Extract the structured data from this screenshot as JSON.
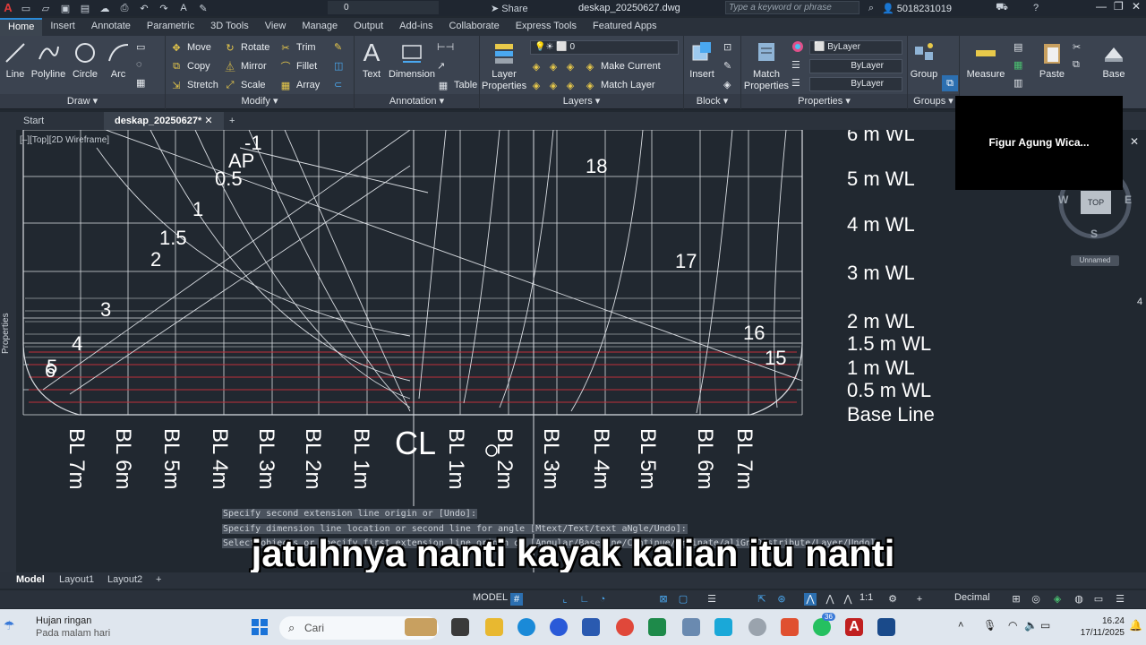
{
  "app": {
    "logo_letter": "A",
    "file_title": "deskap_20250627.dwg",
    "search_placeholder": "Type a keyword or phrase",
    "user_id": "5018231019",
    "share_label": "Share",
    "qat_layer_value": "0",
    "window_controls": [
      "—",
      "❐",
      "✕"
    ]
  },
  "ribbon_tabs": [
    "Home",
    "Insert",
    "Annotate",
    "Parametric",
    "3D Tools",
    "View",
    "Manage",
    "Output",
    "Add-ins",
    "Collaborate",
    "Express Tools",
    "Featured Apps"
  ],
  "ribbon": {
    "draw": {
      "title": "Draw",
      "line": "Line",
      "polyline": "Polyline",
      "circle": "Circle",
      "arc": "Arc"
    },
    "modify": {
      "title": "Modify",
      "move": "Move",
      "rotate": "Rotate",
      "trim": "Trim",
      "copy": "Copy",
      "mirror": "Mirror",
      "fillet": "Fillet",
      "stretch": "Stretch",
      "scale": "Scale",
      "array": "Array"
    },
    "annotation": {
      "title": "Annotation",
      "text": "Text",
      "dimension": "Dimension",
      "table": "Table"
    },
    "layers": {
      "title": "Layers",
      "layer_properties": "Layer Properties",
      "current_layer": "0",
      "make_current": "Make Current",
      "match_layer": "Match Layer"
    },
    "block": {
      "title": "Block",
      "insert": "Insert"
    },
    "properties": {
      "title": "Properties",
      "match_properties": "Match Properties",
      "color": "ByLayer",
      "linetype": "ByLayer",
      "lineweight": "ByLayer"
    },
    "groups": {
      "title": "Groups",
      "group": "Group"
    },
    "utilities": {
      "measure": "Measure"
    },
    "clipboard": {
      "paste": "Paste"
    },
    "view": {
      "base": "Base"
    }
  },
  "doc_tabs": {
    "start": "Start",
    "active": "deskap_20250627*",
    "close": "✕",
    "add": "+"
  },
  "viewport_label": "[–][Top][2D Wireframe]",
  "side_panel_label": "Properties",
  "viewcube": {
    "top": "TOP",
    "west": "W",
    "east": "E",
    "south": "S",
    "ucs": "Unnamed"
  },
  "overlay_name": "Figur Agung Wica...",
  "drawing": {
    "station_labels": [
      "-1",
      "AP",
      "0.5",
      "1",
      "1.5",
      "2",
      "3",
      "4",
      "5",
      "6",
      "15",
      "16",
      "17",
      "18"
    ],
    "waterlines": [
      "6 m WL",
      "5 m WL",
      "4 m WL",
      "3 m WL",
      "2 m WL",
      "1.5 m WL",
      "1 m WL",
      "0.5 m WL",
      "Base Line"
    ],
    "buttocks_left": [
      "BL 7m",
      "BL 6m",
      "BL 5m",
      "BL 4m",
      "BL 3m",
      "BL 2m",
      "BL 1m"
    ],
    "centerline": "CL",
    "buttocks_right": [
      "BL 1m",
      "BL 2m",
      "BL 3m",
      "BL 4m",
      "BL 5m",
      "BL 6m",
      "BL 7m"
    ],
    "right_edge_number": "4"
  },
  "command_history": [
    "Specify second extension line origin or [Undo]:",
    "Specify dimension line location or second line for angle [Mtext/Text/text aNgle/Undo]:",
    "Select objects or specify first extension line origin or [Angular/Baseline/Continue/Ordinate/aliGn/Distribute/Layer/Undo]:"
  ],
  "subtitle": "jatuhnya nanti kayak kalian itu nanti",
  "layout_tabs": {
    "model": "Model",
    "layout1": "Layout1",
    "layout2": "Layout2",
    "add": "+"
  },
  "status": {
    "model": "MODEL",
    "scale": "1:1",
    "units": "Decimal"
  },
  "taskbar": {
    "weather_title": "Hujan ringan",
    "weather_sub": "Pada malam hari",
    "search": "Cari",
    "badge": "36",
    "time": "16.24",
    "date": "17/11/2025"
  },
  "colors": {
    "accent": "#2a8ad8",
    "canvas": "#212830",
    "ribbon": "#3b4350",
    "red_line": "#c0303a"
  }
}
